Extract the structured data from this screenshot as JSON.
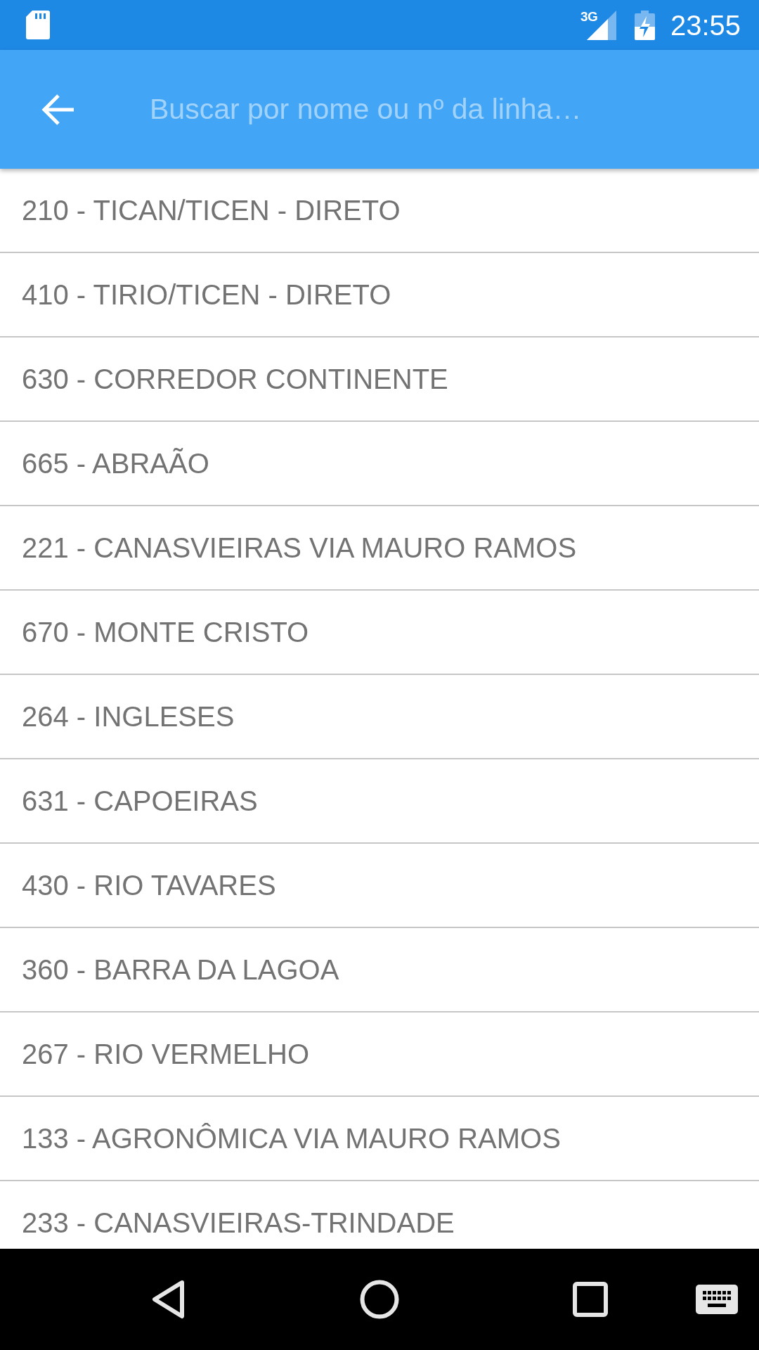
{
  "status_bar": {
    "network": "3G",
    "time": "23:55"
  },
  "search_field": {
    "placeholder": "Buscar por nome ou nº da linha…"
  },
  "lines": [
    {
      "label": "210 - TICAN/TICEN - DIRETO"
    },
    {
      "label": "410 - TIRIO/TICEN - DIRETO"
    },
    {
      "label": "630 - CORREDOR CONTINENTE"
    },
    {
      "label": "665 - ABRAÃO"
    },
    {
      "label": "221 - CANASVIEIRAS VIA MAURO RAMOS"
    },
    {
      "label": "670 - MONTE CRISTO"
    },
    {
      "label": "264 - INGLESES"
    },
    {
      "label": "631 - CAPOEIRAS"
    },
    {
      "label": "430 - RIO TAVARES"
    },
    {
      "label": "360 - BARRA DA LAGOA"
    },
    {
      "label": "267 - RIO VERMELHO"
    },
    {
      "label": "133 - AGRONÔMICA VIA MAURO RAMOS"
    },
    {
      "label": "233 - CANASVIEIRAS-TRINDADE"
    }
  ]
}
